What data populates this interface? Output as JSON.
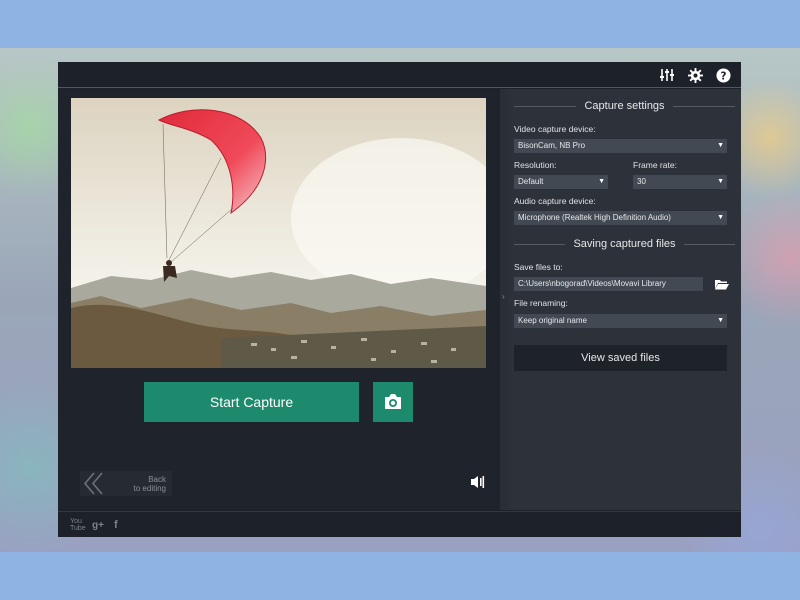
{
  "titlebar": {
    "icons": [
      "equalizer-icon",
      "gear-icon",
      "help-icon"
    ]
  },
  "preview": {
    "description_icon": "paraglider-preview-image"
  },
  "controls": {
    "start_capture": "Start Capture",
    "snapshot_icon": "camera-icon",
    "back_line1": "Back",
    "back_line2": "to editing",
    "audio_icon": "speaker-icon"
  },
  "capture_settings": {
    "title": "Capture settings",
    "video_device_label": "Video capture device:",
    "video_device_value": "BisonCam, NB Pro",
    "resolution_label": "Resolution:",
    "resolution_value": "Default",
    "frame_rate_label": "Frame rate:",
    "frame_rate_value": "30",
    "audio_device_label": "Audio capture device:",
    "audio_device_value": "Microphone (Realtek High Definition Audio)"
  },
  "saving": {
    "title": "Saving captured files",
    "save_to_label": "Save files to:",
    "save_to_value": "C:\\Users\\nbogorad\\Videos\\Movavi Library",
    "renaming_label": "File renaming:",
    "renaming_value": "Keep original name",
    "view_button": "View saved files"
  },
  "footer": {
    "social": [
      "youtube-icon",
      "google-plus-icon",
      "facebook-icon"
    ],
    "youtube_text": "You Tube",
    "gplus_text": "g+",
    "facebook_text": "f"
  },
  "colors": {
    "accent": "#1d8a6e",
    "panel": "#2d323a",
    "background": "#1d2129"
  }
}
